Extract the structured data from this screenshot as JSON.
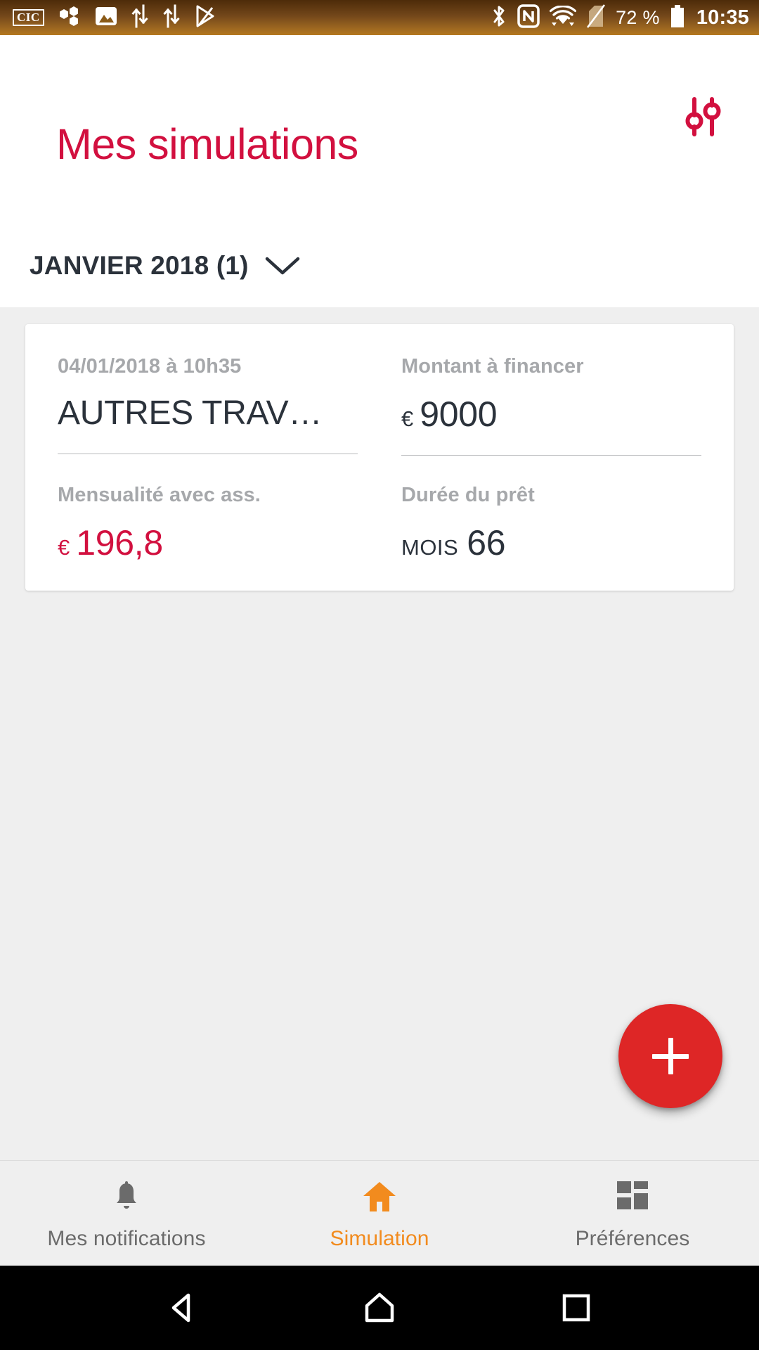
{
  "status_bar": {
    "carrier_badge": "CIC",
    "left_icons": [
      "carrier-cic-icon",
      "cluster-hexagons-icon",
      "photo-gallery-icon",
      "data-transfer-icon",
      "data-transfer-icon-2",
      "play-store-icon"
    ],
    "right_icons": [
      "bluetooth-icon",
      "nfc-icon",
      "wifi-icon",
      "no-sim-icon"
    ],
    "battery_percent": "72 %",
    "battery_icon": "battery-icon",
    "clock": "10:35",
    "background_color": "#8a5a18"
  },
  "header": {
    "title": "Mes simulations",
    "title_color": "#d2103f",
    "filter_icon": "filter-sliders-icon"
  },
  "group": {
    "label": "JANVIER 2018 (1)",
    "count": "1",
    "expand_icon": "chevron-down-icon",
    "expanded": true
  },
  "simulation_card": {
    "date": "04/01/2018 à 10h35",
    "project_type": "AUTRES TRAV…",
    "amount_label": "Montant à financer",
    "amount_unit": "€",
    "amount_value": "9000",
    "monthly_label": "Mensualité avec ass.",
    "monthly_unit": "€",
    "monthly_value": "196,8",
    "monthly_color": "#d2103f",
    "duration_label": "Durée du prêt",
    "duration_unit": "MOIS",
    "duration_value": "66"
  },
  "fab": {
    "icon": "plus-icon",
    "label": "+",
    "color": "#de2626"
  },
  "tabbar": {
    "items": [
      {
        "label": "Mes notifications",
        "icon": "bell-icon",
        "active": false
      },
      {
        "label": "Simulation",
        "icon": "home-icon",
        "active": true
      },
      {
        "label": "Préférences",
        "icon": "grid-tiles-icon",
        "active": false
      }
    ],
    "active_color": "#f28b1e",
    "inactive_color": "#6b6b6b"
  },
  "system_nav": {
    "back": "back-triangle-icon",
    "home": "home-outline-icon",
    "recents": "recents-square-icon"
  }
}
